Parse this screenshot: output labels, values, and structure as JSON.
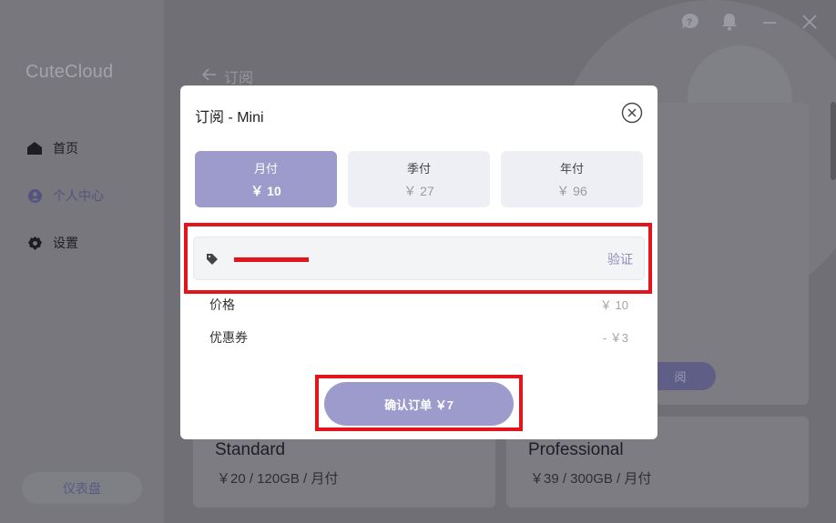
{
  "app": {
    "brand": "CuteCloud",
    "nav": [
      {
        "label": "首页",
        "icon": "home-icon"
      },
      {
        "label": "个人中心",
        "icon": "user-icon"
      },
      {
        "label": "设置",
        "icon": "gear-icon"
      }
    ],
    "dashboard_button": "仪表盘",
    "back_title": "订阅",
    "right_card_button": "阅",
    "plans": [
      {
        "name": "Standard",
        "price": "￥20 / 120GB / 月付"
      },
      {
        "name": "Professional",
        "price": "￥39 / 300GB / 月付"
      }
    ],
    "top_icons": [
      "help-icon",
      "bell-icon",
      "minimize-icon",
      "close-icon"
    ]
  },
  "modal": {
    "title": "订阅 - Mini",
    "periods": [
      {
        "label": "月付",
        "price": "￥ 10",
        "selected": true
      },
      {
        "label": "季付",
        "price": "￥ 27",
        "selected": false
      },
      {
        "label": "年付",
        "price": "￥ 96",
        "selected": false
      }
    ],
    "coupon": {
      "value": "",
      "placeholder": "",
      "verify_label": "验证"
    },
    "price_label": "价格",
    "price_value": "￥ 10",
    "coupon_label": "优惠券",
    "coupon_value": "- ￥3",
    "confirm_label": "确认订单 ￥7"
  },
  "colors": {
    "accent": "#9c9bcb",
    "highlight": "#e3141c",
    "overlay": "#6f6f75"
  }
}
